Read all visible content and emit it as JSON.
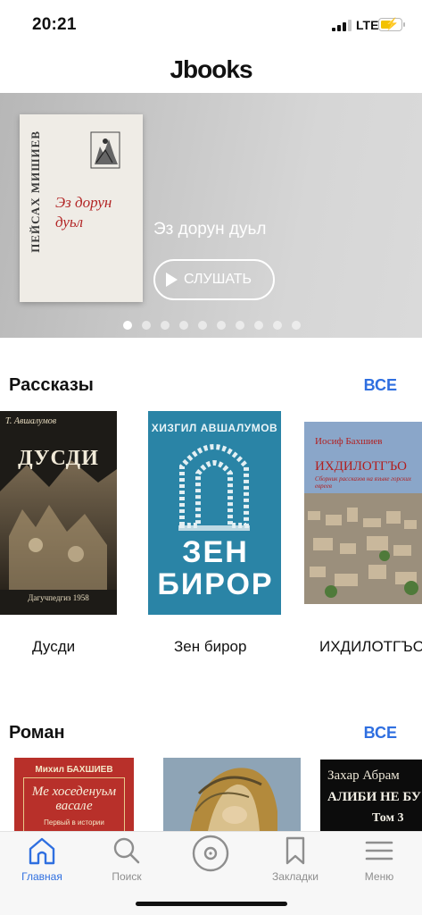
{
  "status_bar": {
    "time": "20:21",
    "network": "LTE"
  },
  "app": {
    "title": "Jbooks"
  },
  "hero": {
    "cover_author": "ПЕЙСАХ МИШИЕВ",
    "cover_title": "Эз дорун дуьл",
    "title": "Эз дорун дуьл",
    "listen_label": "СЛУШАТЬ",
    "pages": 10,
    "active_page": 1
  },
  "sections": [
    {
      "title": "Рассказы",
      "see_all": "ВСЕ",
      "books": [
        {
          "label": "Дусди",
          "cover_author": "Т. Авшалумов",
          "cover_title": "ДУСДИ",
          "cover_footer": "Дагучпедгиз 1958"
        },
        {
          "label": "Зен бирор",
          "cover_author": "ХИЗГИЛ АВШАЛУМОВ",
          "cover_title": "ЗЕН БИРОР"
        },
        {
          "label": "ИХДИЛОТГЪО",
          "cover_author": "Иосиф Бахшиев",
          "cover_title": "ИХДИЛОТГЪО",
          "cover_subtitle": "Сборник рассказов на языке горских евреев"
        }
      ]
    },
    {
      "title": "Роман",
      "see_all": "ВСЕ",
      "books": [
        {
          "cover_author": "Михил БАХШИЕВ",
          "cover_title": "Ме хоседенуьм васале",
          "cover_subtitle": "Первый в истории"
        },
        {
          "cover_title": ""
        },
        {
          "cover_author": "Захар Абрам",
          "cover_title": "АЛИБИ НЕ БУ",
          "cover_subtitle": "Том 3"
        }
      ]
    }
  ],
  "tabbar": {
    "items": [
      {
        "label": "Главная",
        "icon": "home-icon",
        "active": true
      },
      {
        "label": "Поиск",
        "icon": "search-icon",
        "active": false
      },
      {
        "label": "",
        "icon": "disc-icon",
        "active": false
      },
      {
        "label": "Закладки",
        "icon": "bookmark-icon",
        "active": false
      },
      {
        "label": "Меню",
        "icon": "menu-icon",
        "active": false
      }
    ]
  },
  "colors": {
    "accent": "#2f6fe0",
    "inactive": "#8e8e8e",
    "battery": "#f2c200"
  }
}
